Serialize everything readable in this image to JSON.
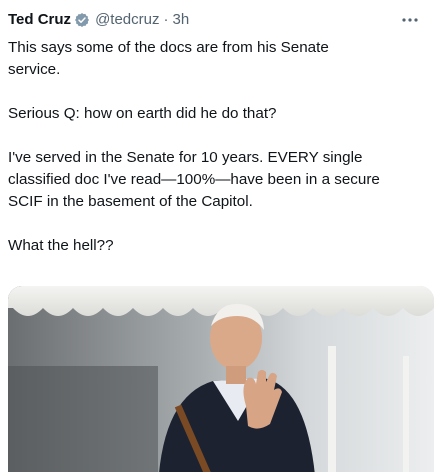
{
  "tweet": {
    "author": {
      "display_name": "Ted Cruz",
      "handle": "@tedcruz",
      "verified_icon": "verified-badge-icon",
      "badge_color": "#829aab"
    },
    "separator": "·",
    "timestamp": "3h",
    "more_icon": "more-horizontal-icon",
    "paragraphs": [
      "This says some of the docs are from his Senate\nservice.",
      "Serious Q: how on earth did he do that?",
      "I've served in the Senate for 10 years. EVERY single\nclassified doc I've read—100%—have been in a secure\nSCIF in the basement of the Capitol.",
      "What the hell??"
    ],
    "media": {
      "kind": "photo"
    }
  },
  "colors": {
    "text": "#0f1419",
    "secondary": "#536471",
    "background": "#ffffff"
  }
}
